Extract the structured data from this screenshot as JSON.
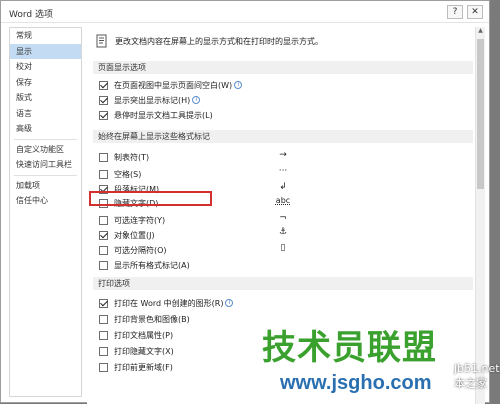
{
  "window": {
    "title": "Word 选项",
    "help_label": "?",
    "close_label": "✕"
  },
  "sidebar": {
    "items": [
      {
        "label": "常规",
        "selected": false
      },
      {
        "label": "显示",
        "selected": true
      },
      {
        "label": "校对",
        "selected": false
      },
      {
        "label": "保存",
        "selected": false
      },
      {
        "label": "版式",
        "selected": false
      },
      {
        "label": "语言",
        "selected": false
      },
      {
        "label": "高级",
        "selected": false
      },
      {
        "label": "自定义功能区",
        "selected": false
      },
      {
        "label": "快速访问工具栏",
        "selected": false
      },
      {
        "label": "加载项",
        "selected": false
      },
      {
        "label": "信任中心",
        "selected": false
      }
    ]
  },
  "intro": {
    "text": "更改文档内容在屏幕上的显示方式和在打印时的显示方式。",
    "icon": "document-display-icon"
  },
  "sections": {
    "page_display": {
      "header": "页面显示选项",
      "options": [
        {
          "label": "在页面视图中显示页面间空白(W)",
          "checked": true,
          "info": true
        },
        {
          "label": "显示突出显示标记(H)",
          "checked": true,
          "info": true
        },
        {
          "label": "悬停时显示文档工具提示(L)",
          "checked": true,
          "info": false
        }
      ]
    },
    "formatting_marks": {
      "header": "始终在屏幕上显示这些格式标记",
      "options": [
        {
          "label": "制表符(T)",
          "checked": false,
          "symbol": "→"
        },
        {
          "label": "空格(S)",
          "checked": false,
          "symbol": "···"
        },
        {
          "label": "段落标记(M)",
          "checked": true,
          "symbol": "↲"
        },
        {
          "label": "隐藏文字(D)",
          "checked": false,
          "symbol": "abc"
        },
        {
          "label": "可选连字符(Y)",
          "checked": false,
          "symbol": "¬"
        },
        {
          "label": "对象位置(J)",
          "checked": true,
          "symbol": "⚓"
        },
        {
          "label": "可选分隔符(O)",
          "checked": false,
          "symbol": "▯"
        },
        {
          "label": "显示所有格式标记(A)",
          "checked": false,
          "symbol": ""
        }
      ]
    },
    "print": {
      "header": "打印选项",
      "options": [
        {
          "label": "打印在 Word 中创建的图形(R)",
          "checked": true,
          "info": true
        },
        {
          "label": "打印背景色和图像(B)",
          "checked": false,
          "info": false
        },
        {
          "label": "打印文档属性(P)",
          "checked": false,
          "info": false
        },
        {
          "label": "打印隐藏文字(X)",
          "checked": false,
          "info": false
        },
        {
          "label": "打印前更新域(F)",
          "checked": false,
          "info": false
        }
      ]
    }
  },
  "watermark": {
    "text": "技术员联盟",
    "url": "www.jsgho.com",
    "edge_text": "jb51.net 本之家"
  },
  "colors": {
    "selected_nav": "#c4dcf3",
    "highlight_box": "#d32f2f",
    "watermark_green": "#3aa12f",
    "watermark_blue": "#2a6fb0"
  }
}
